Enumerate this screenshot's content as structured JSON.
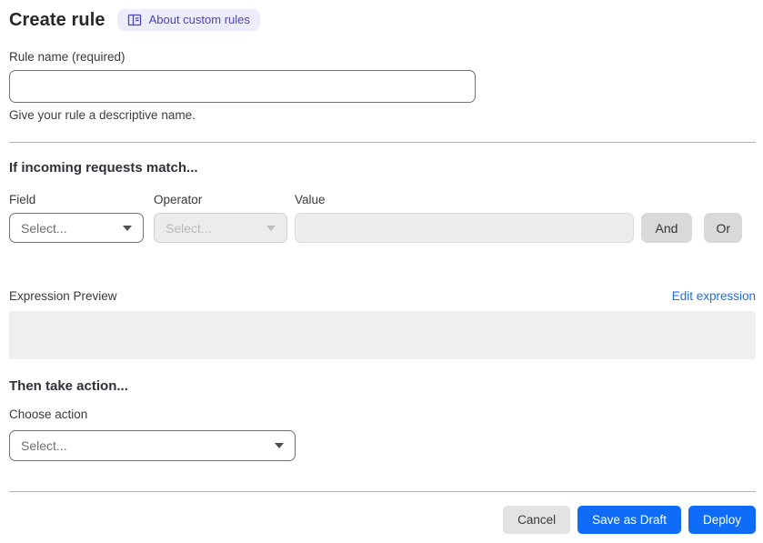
{
  "header": {
    "title": "Create rule",
    "badge": {
      "label": "About custom rules",
      "icon": "book-icon"
    }
  },
  "rule_name": {
    "label": "Rule name (required)",
    "value": "",
    "helper": "Give your rule a descriptive name."
  },
  "match_section": {
    "heading": "If incoming requests match...",
    "field": {
      "label": "Field",
      "selected_value": "Select...",
      "icon": "chevron-down-icon"
    },
    "operator": {
      "label": "Operator",
      "selected_value": "Select...",
      "disabled": true,
      "icon": "chevron-down-icon"
    },
    "value": {
      "label": "Value",
      "value": "",
      "disabled": true
    },
    "and_button_label": "And",
    "or_button_label": "Or",
    "expression_preview": {
      "label": "Expression Preview",
      "edit_link_label": "Edit expression",
      "content": ""
    }
  },
  "action_section": {
    "heading": "Then take action...",
    "choose_action": {
      "label": "Choose action",
      "selected_value": "Select...",
      "icon": "chevron-down-icon"
    }
  },
  "footer": {
    "cancel_label": "Cancel",
    "save_draft_label": "Save as Draft",
    "deploy_label": "Deploy"
  },
  "colors": {
    "primary_blue": "#0f6cf8",
    "link_blue": "#1a6fe8",
    "badge_bg": "#edecfc",
    "badge_text": "#4b44bd",
    "disabled_bg": "#ececec",
    "neutral_button_bg": "#d9d9d9",
    "preview_box_bg": "#efefef"
  }
}
